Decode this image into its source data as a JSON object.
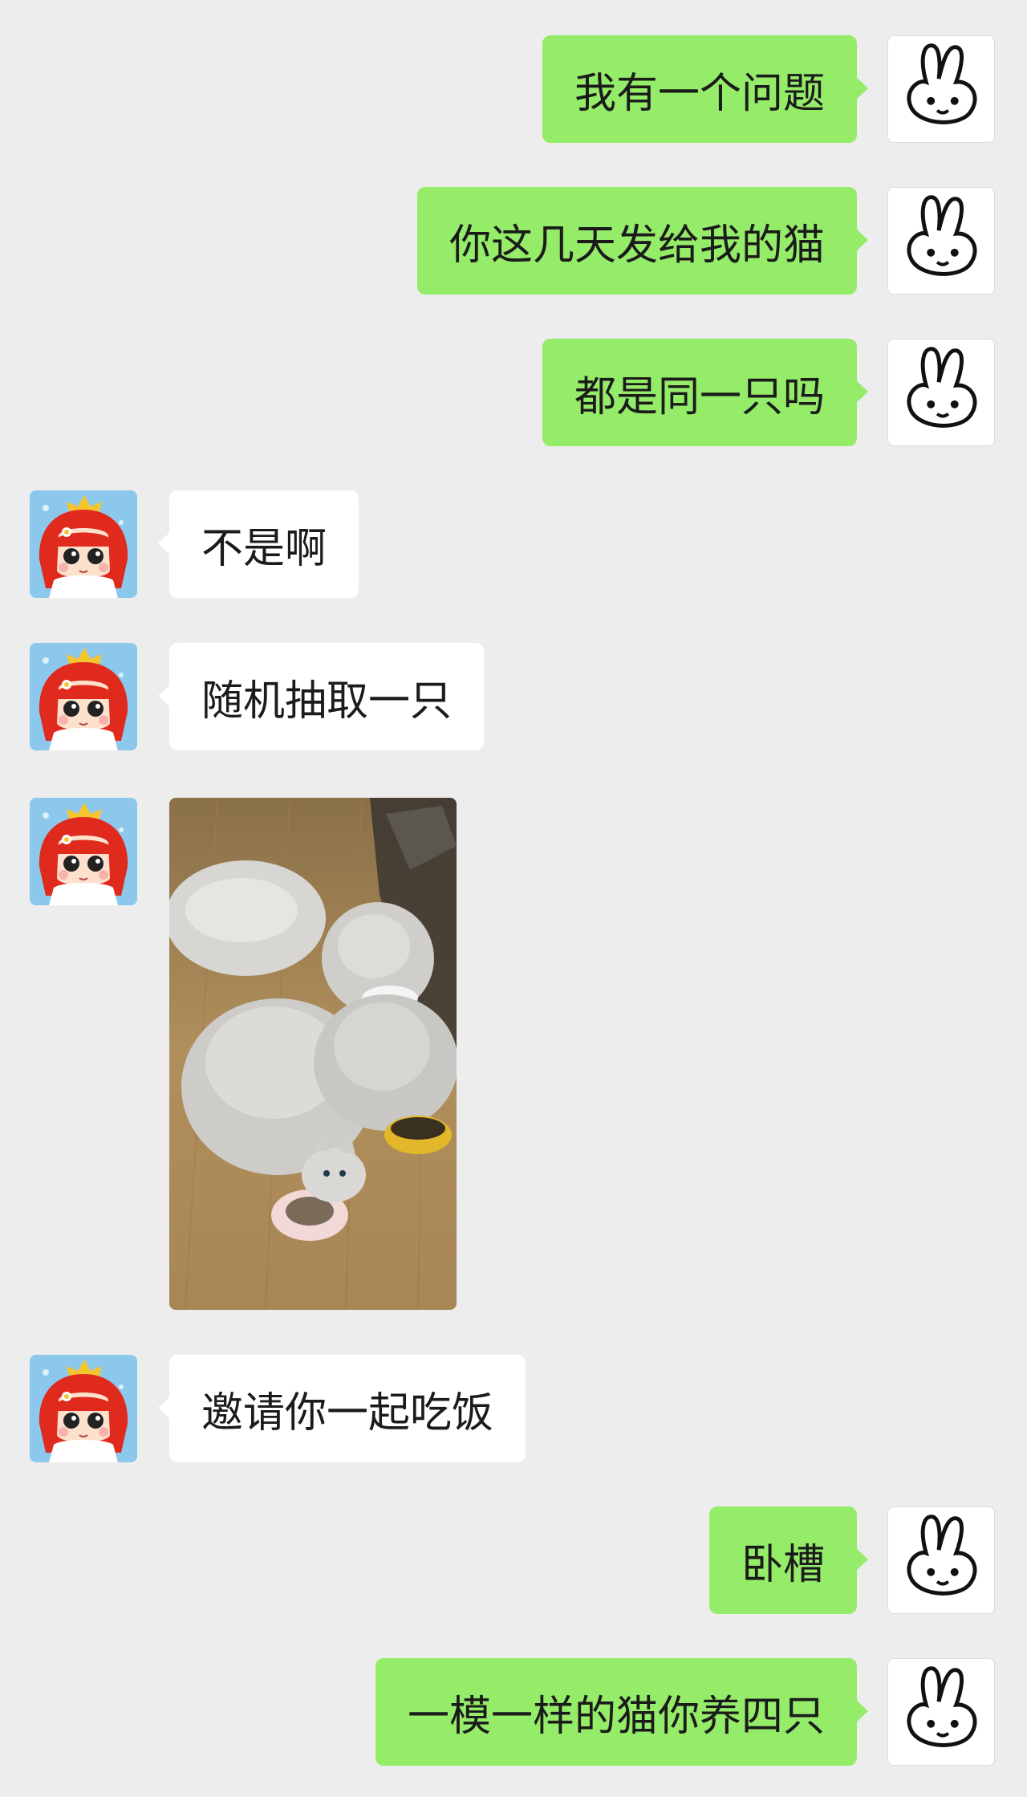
{
  "messages": [
    {
      "sender": "me",
      "text": "我有一个问题"
    },
    {
      "sender": "me",
      "text": "你这几天发给我的猫"
    },
    {
      "sender": "me",
      "text": "都是同一只吗"
    },
    {
      "sender": "them",
      "text": "不是啊"
    },
    {
      "sender": "them",
      "text": "随机抽取一只"
    },
    {
      "sender": "them",
      "type": "image",
      "icon": "photo-of-cats-eating"
    },
    {
      "sender": "them",
      "text": "邀请你一起吃饭"
    },
    {
      "sender": "me",
      "text": "卧槽"
    },
    {
      "sender": "me",
      "text": "一模一样的猫你养四只"
    }
  ],
  "avatars": {
    "me": "bunny-avatar-icon",
    "them": "red-hair-girl-avatar-icon"
  },
  "colors": {
    "background": "#ededed",
    "my_bubble": "#95ec69",
    "their_bubble": "#ffffff"
  }
}
